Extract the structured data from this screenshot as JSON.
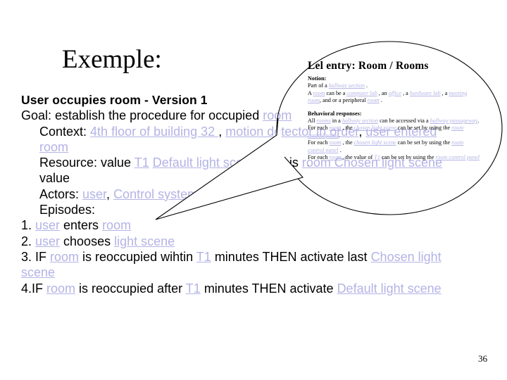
{
  "slide": {
    "title": "Exemple:",
    "number": "36"
  },
  "usecase": {
    "heading": "User occupies room - Version  1",
    "goal_prefix": "Goal: establish the procedure for occupied ",
    "goal_link": "room",
    "context_label": "Context: ",
    "context_link1": "4th floor of building 32 ",
    "context_sep1": ", ",
    "context_link2": "motion detector in order",
    "context_sep2": ", ",
    "context_link3": "user entered room",
    "resource_label": "Resource: value ",
    "resource_link1": "T1",
    "resource_space": " ",
    "resource_link2": "Default light scene ",
    "resource_mid": "for this ",
    "resource_link3": "room",
    "resource_link4": " Chosen light scene ",
    "resource_tail": "value",
    "actors_label": "Actors: ",
    "actors_link1": "user",
    "actors_sep": ", ",
    "actors_link2": "Control system",
    "episodes_label": "Episodes:",
    "ep1_num": "1. ",
    "ep1_link1": "user",
    "ep1_mid": " enters ",
    "ep1_link2": "room",
    "ep2_num": "2. ",
    "ep2_link1": "user",
    "ep2_mid": " chooses ",
    "ep2_link2": "light scene",
    "ep3_num": "3. IF ",
    "ep3_link1": "room",
    "ep3_mid1": " is reoccupied wihtin ",
    "ep3_link2": "T1",
    "ep3_mid2": " minutes THEN activate last ",
    "ep3_link3": "Chosen light scene",
    "ep4_num": "4.IF ",
    "ep4_link1": "room",
    "ep4_mid1": " is reoccupied after ",
    "ep4_link2": "T1",
    "ep4_mid2": " minutes THEN activate ",
    "ep4_link3": "Default light scene"
  },
  "bubble": {
    "title": "Lel  entry: Room / Rooms",
    "notion_label": "Notion:",
    "n1_pre": "Part of a ",
    "n1_link": "hallway section",
    "n1_post": " .",
    "n2_pre": "A ",
    "n2_link1": "room",
    "n2_mid1": " can be a ",
    "n2_link2": "computer lab",
    "n2_mid2": " , an ",
    "n2_link3": "office",
    "n2_mid3": " , a ",
    "n2_link4": "hardware lab",
    "n2_mid4": " , a ",
    "n2_link5": "meeting room",
    "n2_mid5": ", and or a peripheral ",
    "n2_link6": "room",
    "n2_post": " .",
    "behavior_label": "Behavioral responses:",
    "b1_pre": "All ",
    "b1_link1": "rooms",
    "b1_mid1": " in a ",
    "b1_link2": "hallway section",
    "b1_mid2": " can be accessed via a ",
    "b1_link3": "hallway passageway",
    "b1_post": ".",
    "b2_pre": "For each ",
    "b2_link1": "room",
    "b2_mid1": " , the ",
    "b2_link2": "chosen light scene",
    "b2_mid2": " can be set by using the ",
    "b2_link3": "room control panel",
    "b2_post": ".",
    "b3_pre": "For each ",
    "b3_link1": "room",
    "b3_mid1": " , the ",
    "b3_link2": "chosen light scene",
    "b3_mid2": " can be set by using the ",
    "b3_link3": "room control panel",
    "b3_post": " .",
    "b4_pre": "For each ",
    "b4_link1": "room",
    "b4_mid1": " , the value of ",
    "b4_link2": "T1",
    "b4_mid2": " can be set by using the ",
    "b4_link3": "room control panel",
    "b4_post": " ."
  },
  "colors": {
    "hyperlink": "#b3b3e6",
    "text": "#000000",
    "outline": "#000000",
    "background": "#ffffff"
  }
}
